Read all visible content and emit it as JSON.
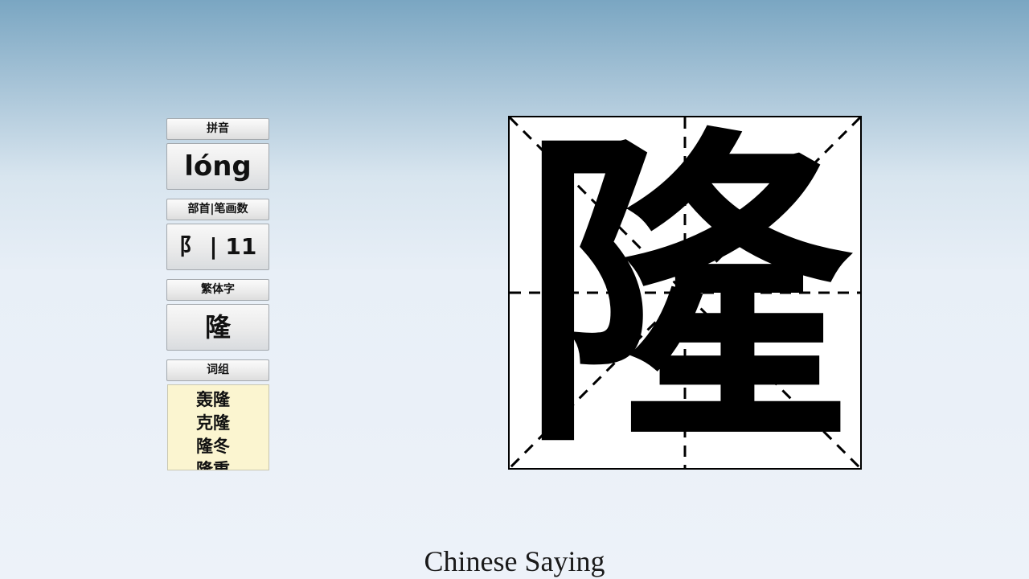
{
  "panel": {
    "pinyin_label": "拼音",
    "pinyin_value": "lóng",
    "radical_label": "部首|笔画数",
    "radical_value": "阝 | 11",
    "traditional_label": "繁体字",
    "traditional_value": "隆",
    "words_label": "词组",
    "words": [
      "轰隆",
      "克隆",
      "隆冬",
      "隆重"
    ]
  },
  "character": "隆",
  "footer": {
    "title": "Chinese Saying"
  }
}
